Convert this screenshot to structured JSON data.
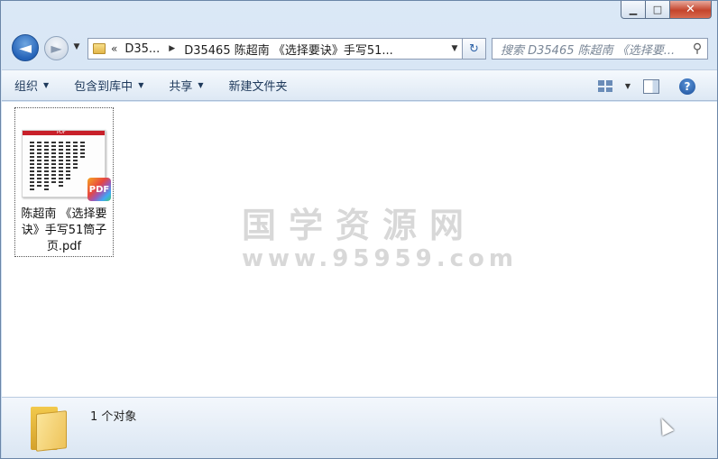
{
  "window": {
    "caption_buttons": {
      "minimize": "▁",
      "maximize": "□",
      "close": "✕"
    }
  },
  "nav": {
    "back_icon": "◄",
    "forward_icon": "►",
    "recent_icon": "▼"
  },
  "address": {
    "chevron": "«",
    "segment_short": "D35...",
    "separator": "▶",
    "path": "D35465 陈超南 《选择要诀》手写51...",
    "dropdown": "▼",
    "refresh_icon": "↻"
  },
  "search": {
    "placeholder": "搜索 D35465 陈超南 《选择要...",
    "icon": "⚲"
  },
  "toolbar": {
    "organize": "组织",
    "include_in_library": "包含到库中",
    "share": "共享",
    "new_folder": "新建文件夹",
    "dropdown_arrow": "▼",
    "help": "?"
  },
  "files": [
    {
      "name": "陈超南 《选择要诀》手写51筒子页.pdf",
      "thumb_header": "PDF",
      "badge": "PDF"
    }
  ],
  "watermark": {
    "title": "国学资源网",
    "url": "www.95959.com"
  },
  "status": {
    "count": "1 个对象"
  }
}
